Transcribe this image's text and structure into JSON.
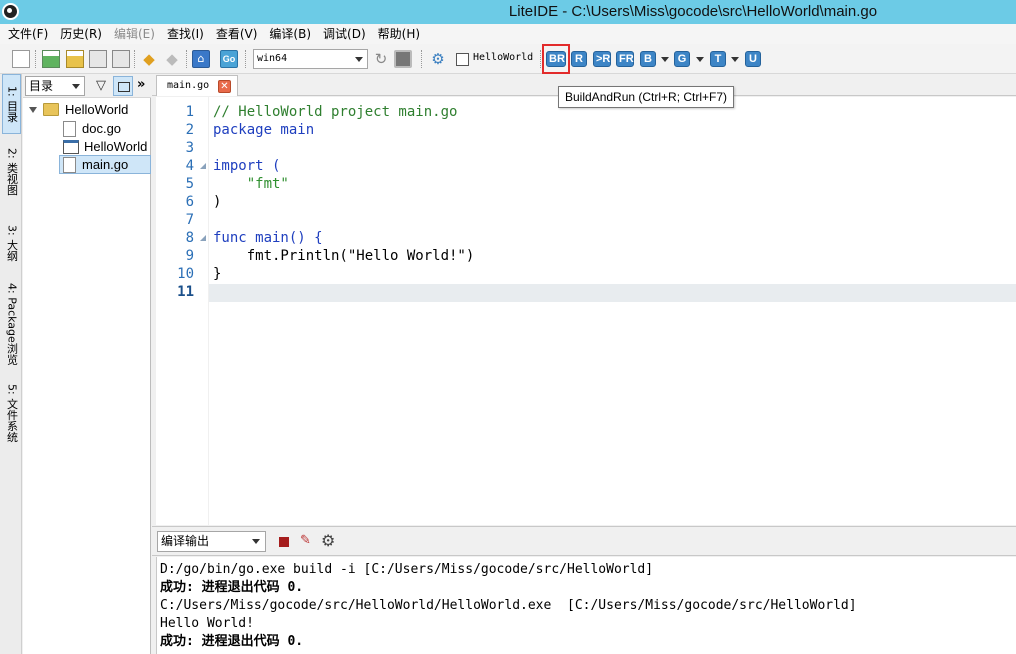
{
  "window": {
    "title": "LiteIDE - C:\\Users\\Miss\\gocode\\src\\HelloWorld\\main.go"
  },
  "menu": {
    "items": [
      {
        "label": "文件(F)",
        "enabled": true
      },
      {
        "label": "历史(R)",
        "enabled": true
      },
      {
        "label": "编辑(E)",
        "enabled": false
      },
      {
        "label": "查找(I)",
        "enabled": true
      },
      {
        "label": "查看(V)",
        "enabled": true
      },
      {
        "label": "编译(B)",
        "enabled": true
      },
      {
        "label": "调试(D)",
        "enabled": true
      },
      {
        "label": "帮助(H)",
        "enabled": true
      }
    ]
  },
  "toolbar": {
    "go_label": "Go",
    "env_select": "win64",
    "project_checkbox_label": "HelloWorld",
    "build_buttons": [
      "BR",
      "R",
      ">R",
      "FR",
      "B",
      "G",
      "T",
      "U"
    ],
    "tooltip": "BuildAndRun (Ctrl+R; Ctrl+F7)",
    "highlight_color": "#e22b2b"
  },
  "side_tabs": [
    "1: 目录",
    "2: 类视图",
    "3: 大纲",
    "4: Package浏览",
    "5: 文件系统"
  ],
  "project_panel": {
    "view_select": "目录",
    "more_label": "»",
    "tree": [
      {
        "label": "HelloWorld",
        "type": "folder"
      },
      {
        "label": "doc.go",
        "type": "file"
      },
      {
        "label": "HelloWorld",
        "type": "exe"
      },
      {
        "label": "main.go",
        "type": "file",
        "selected": true
      }
    ]
  },
  "editor": {
    "tab_label": "main.go",
    "current_line": 11,
    "lines": [
      {
        "num": "1",
        "text": "// HelloWorld project main.go"
      },
      {
        "num": "2",
        "text": "package main"
      },
      {
        "num": "3",
        "text": ""
      },
      {
        "num": "4",
        "text": "import ("
      },
      {
        "num": "5",
        "text": "    \"fmt\""
      },
      {
        "num": "6",
        "text": ")"
      },
      {
        "num": "7",
        "text": ""
      },
      {
        "num": "8",
        "text": "func main() {"
      },
      {
        "num": "9",
        "text": "    fmt.Println(\"Hello World!\")"
      },
      {
        "num": "10",
        "text": "}"
      },
      {
        "num": "11",
        "text": ""
      }
    ]
  },
  "output": {
    "panel_select": "编译输出",
    "lines": [
      "D:/go/bin/go.exe build -i [C:/Users/Miss/gocode/src/HelloWorld]",
      "成功: 进程退出代码 0.",
      "C:/Users/Miss/gocode/src/HelloWorld/HelloWorld.exe  [C:/Users/Miss/gocode/src/HelloWorld]",
      "Hello World!",
      "成功: 进程退出代码 0."
    ]
  }
}
